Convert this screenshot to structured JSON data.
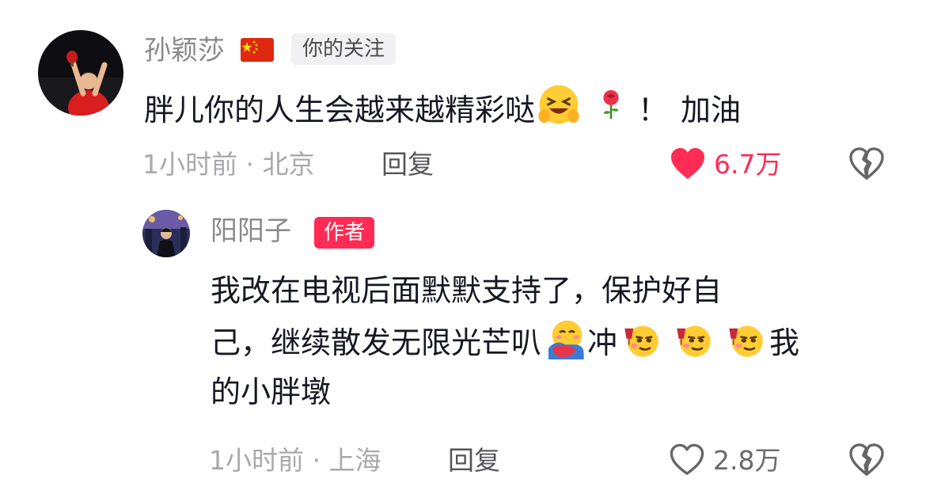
{
  "comment": {
    "username": "孙颖莎",
    "flag_icon": "china-flag-icon",
    "follow_tag": "你的关注",
    "text_main": "胖儿你的人生会越来越精彩哒",
    "text_exclaim": "！",
    "text_end": "加油",
    "emoji_1": "grinning-squint-hands-icon",
    "emoji_2": "rose-icon",
    "meta": "1小时前 · 北京",
    "reply_label": "回复",
    "like_count": "6.7万",
    "liked": true,
    "like_color": "#fe2c55"
  },
  "reply": {
    "username": "阳阳子",
    "author_tag": "作者",
    "line1": "我改在电视后面默默支持了，保护好自",
    "line2a": "己，继续散发无限光芒叭",
    "line2b": "冲",
    "line2c": "我",
    "line3": "的小胖墩",
    "emoji_hug": "hugging-face-icon",
    "emoji_cheers": "cheers-face-icon",
    "meta": "1小时前 · 上海",
    "reply_label": "回复",
    "like_count": "2.8万",
    "liked": false
  },
  "colors": {
    "accent": "#fe2c55",
    "text": "#161823",
    "muted": "#a9a9ad"
  }
}
